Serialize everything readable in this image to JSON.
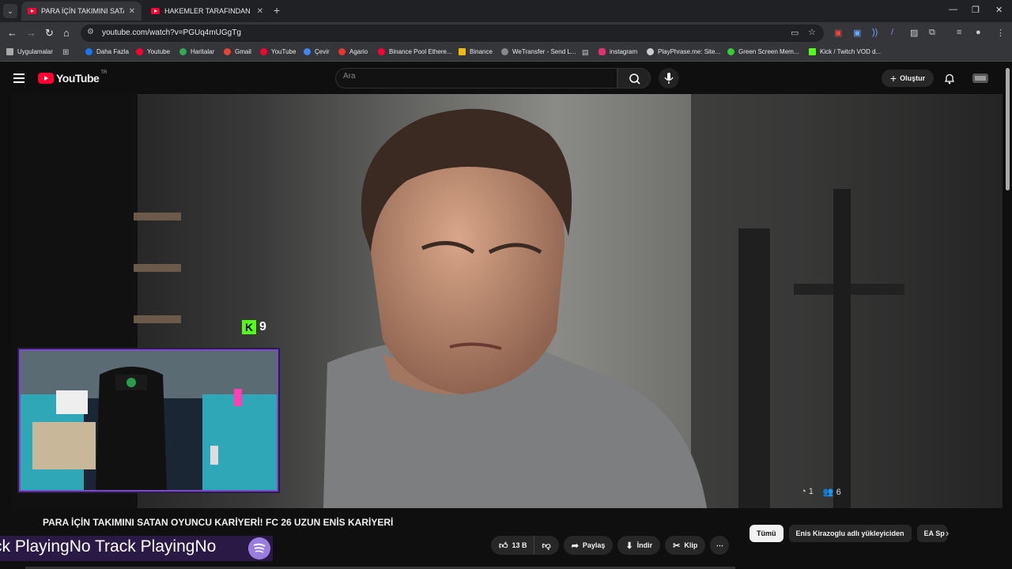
{
  "browser": {
    "tabs": [
      {
        "title": "PARA İÇİN TAKIMINI SATAN OYU",
        "active": true
      },
      {
        "title": "HAKEMLER TARAFINDAN KOLL",
        "active": false
      }
    ],
    "url": "youtube.com/watch?v=PGUq4mUGgTg",
    "bookmarks": [
      {
        "label": "Uygulamalar",
        "icon": "apps-icon"
      },
      {
        "label": "Daha Fazla",
        "icon": "facebook-icon",
        "color": "#1877f2"
      },
      {
        "label": "Youtube",
        "icon": "youtube-icon",
        "color": "#ff0033"
      },
      {
        "label": "Haritalar",
        "icon": "maps-icon",
        "color": "#34a853"
      },
      {
        "label": "Gmail",
        "icon": "gmail-icon",
        "color": "#ea4335"
      },
      {
        "label": "YouTube",
        "icon": "youtube-icon",
        "color": "#ff0033"
      },
      {
        "label": "Çevir",
        "icon": "translate-icon",
        "color": "#4285f4"
      },
      {
        "label": "Agario",
        "icon": "agario-icon",
        "color": "#e33"
      },
      {
        "label": "Binance Pool Ethere...",
        "icon": "youtube-icon",
        "color": "#ff0033"
      },
      {
        "label": "Binance",
        "icon": "binance-icon",
        "color": "#f0b90b"
      },
      {
        "label": "WeTransfer - Send L...",
        "icon": "wetransfer-icon",
        "color": "#888"
      },
      {
        "label": "instagram",
        "icon": "instagram-icon",
        "color": "#e1306c"
      },
      {
        "label": "PlayPhrase.me: Site...",
        "icon": "playphrase-icon",
        "color": "#ccc"
      },
      {
        "label": "Green Screen Mem...",
        "icon": "greenscreen-icon",
        "color": "#3c3"
      },
      {
        "label": "Kick / Twitch VOD d...",
        "icon": "kick-icon",
        "color": "#53fc18"
      }
    ]
  },
  "youtube": {
    "logo_text": "YouTube",
    "country_code": "TR",
    "search_placeholder": "Ara",
    "create_label": "Oluştur"
  },
  "video": {
    "title": "PARA İÇİN TAKIMINI SATAN OYUNCU KARİYERİ! FC 26 UZUN ENİS KARİYERİ",
    "overlay_kick_count": "9",
    "overlay_stat_1": "1",
    "overlay_stat_2": "6",
    "ticker_text": "ck PlayingNo Track PlayingNo",
    "likes": "13 B",
    "share_label": "Paylaş",
    "download_label": "İndir",
    "clip_label": "Klip"
  },
  "recommendation_chips": [
    "Tümü",
    "Enis Kirazoglu adlı yükleyiciden",
    "EA Sp"
  ],
  "colors": {
    "accent": "#ff0033",
    "kick_green": "#53fc18",
    "overlay_purple": "#7a4cc2"
  }
}
